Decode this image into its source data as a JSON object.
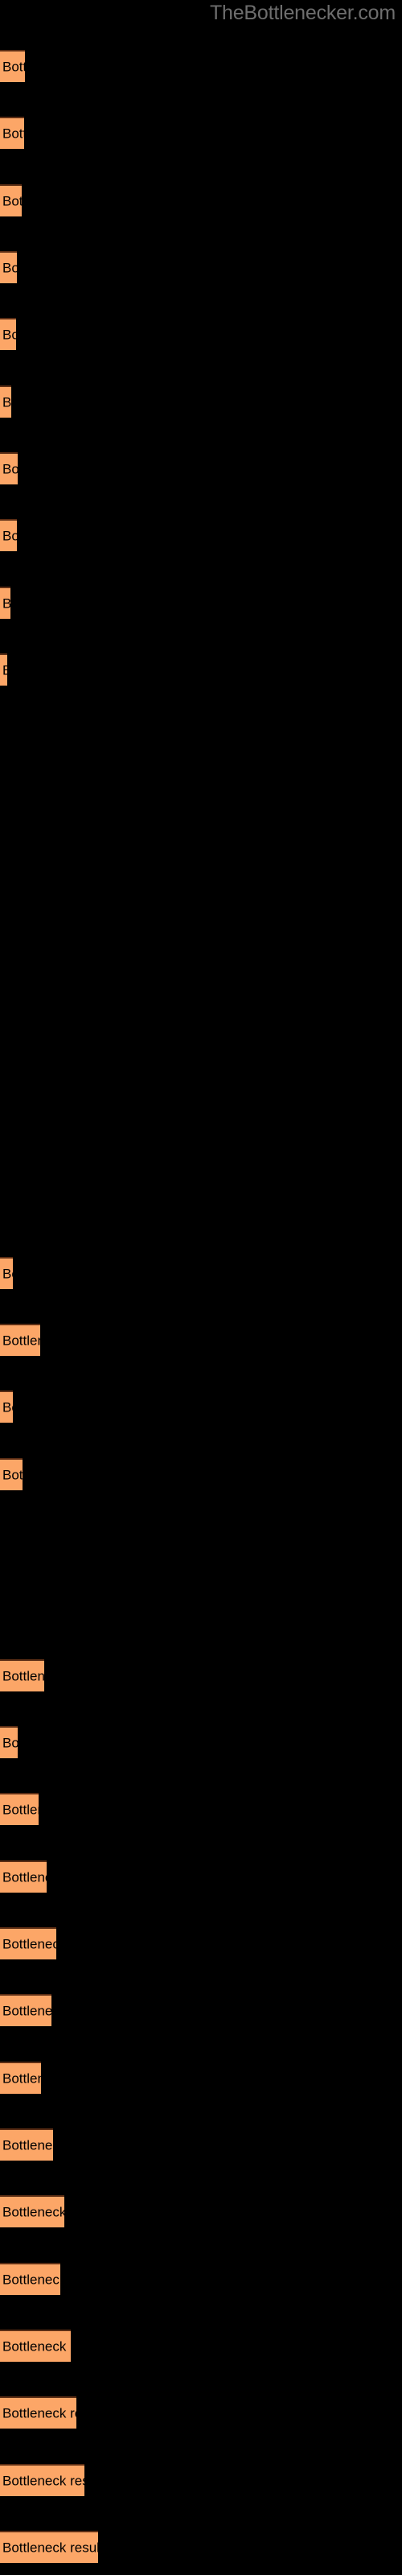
{
  "site": {
    "watermark": "TheBottlenecker.com"
  },
  "chart_data": {
    "type": "bar",
    "orientation": "horizontal",
    "title": "",
    "subtitle": "",
    "xlabel": "",
    "ylabel": "",
    "grid": false,
    "legend": null,
    "background_color": "#000000",
    "bar_color": "#FCA667",
    "bar_edge_color": "#5b2d14",
    "label_color": "#000000",
    "watermark_color": "#6e6e6e",
    "xlim": [
      0,
      500
    ],
    "bar_label_text": "Bottleneck result",
    "categories": [
      "Bottleneck result",
      "Bottleneck result",
      "Bottleneck result",
      "Bottleneck result",
      "Bottleneck result",
      "Bottleneck result",
      "Bottleneck result",
      "Bottleneck result",
      "Bottleneck result",
      "Bottleneck result",
      "Bottleneck result",
      "Bottleneck result",
      "Bottleneck result",
      "Bottleneck result",
      "Bottleneck result",
      "Bottleneck result",
      "Bottleneck result",
      "Bottleneck result",
      "Bottleneck result",
      "Bottleneck result",
      "Bottleneck result",
      "Bottleneck result",
      "Bottleneck result",
      "Bottleneck result",
      "Bottleneck result",
      "Bottleneck result",
      "Bottleneck result",
      "Bottleneck result",
      "Bottleneck result",
      "Bottleneck result",
      "Bottleneck result",
      "Bottleneck result",
      "Bottleneck result",
      "Bottleneck result",
      "Bottleneck result",
      "Bottleneck result",
      "Bottleneck result",
      "Bottleneck result"
    ],
    "values": [
      31,
      30,
      27,
      21,
      20,
      14,
      22,
      21,
      13,
      9,
      0,
      0,
      0,
      0,
      0,
      0,
      0,
      0,
      16,
      50,
      16,
      28,
      0,
      0,
      55,
      22,
      48,
      58,
      70,
      64,
      51,
      66,
      80,
      75,
      88,
      95,
      105,
      122
    ],
    "bar_tops": [
      62,
      148,
      229,
      310,
      391,
      472,
      553,
      634,
      715,
      796,
      877,
      958,
      1039,
      1120,
      1201,
      1282,
      1363,
      1444,
      1525,
      1606,
      1687,
      1768,
      1849,
      1930,
      1930,
      2011,
      2092,
      2173,
      2254,
      2335,
      2416,
      2497,
      2578,
      2659,
      2740,
      2821,
      2902,
      2983
    ]
  }
}
